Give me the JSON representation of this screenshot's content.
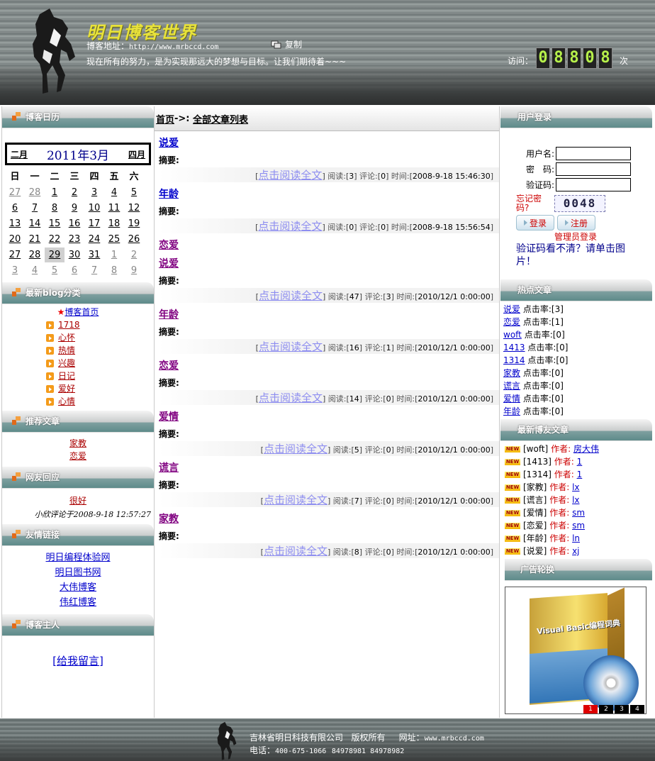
{
  "header": {
    "logo_text": "明日博客世界",
    "address_label": "博客地址：",
    "address_url": "http://www.mrbccd.com",
    "copy_label": "复制",
    "slogan": "现在所有的努力，是为实现那远大的梦想与目标。让我们期待着~~~",
    "visit_label": "访问：",
    "visit_count": [
      "0",
      "8",
      "8",
      "0",
      "8"
    ],
    "visit_unit": "次"
  },
  "left": {
    "calendar": {
      "title": "博客日历",
      "prev": "二月",
      "month": "2011年3月",
      "next": "四月",
      "weekdays": [
        "日",
        "一",
        "二",
        "三",
        "四",
        "五",
        "六"
      ],
      "days": [
        [
          "27",
          "28",
          "1",
          "2",
          "3",
          "4",
          "5"
        ],
        [
          "6",
          "7",
          "8",
          "9",
          "10",
          "11",
          "12"
        ],
        [
          "13",
          "14",
          "15",
          "16",
          "17",
          "18",
          "19"
        ],
        [
          "20",
          "21",
          "22",
          "23",
          "24",
          "25",
          "26"
        ],
        [
          "27",
          "28",
          "29",
          "30",
          "31",
          "1",
          "2"
        ],
        [
          "3",
          "4",
          "5",
          "6",
          "7",
          "8",
          "9"
        ]
      ]
    },
    "categories": {
      "title": "最新blog分类",
      "home": "博客首页",
      "items": [
        "1718",
        "心怀",
        "热情",
        "兴趣",
        "日记",
        "爱好",
        "心情"
      ]
    },
    "recommended": {
      "title": "推荐文章",
      "items": [
        "家教",
        "恋爱"
      ]
    },
    "replies": {
      "title": "网友回应",
      "text": "很好",
      "meta": "小欣评论于2008-9-18 12:57:27"
    },
    "links": {
      "title": "友情链接",
      "items": [
        "明日编程体验网",
        "明日图书网",
        "大伟博客",
        "伟红博客"
      ]
    },
    "owner": {
      "title": "博客主人",
      "message_link": "[给我留言]"
    }
  },
  "middle": {
    "crumb_home": "首页",
    "crumb_sep": "->:",
    "crumb_current": "全部文章列表",
    "summary_label": "摘要:",
    "read_more": "点击阅读全文",
    "read_label": "阅读:",
    "comment_label": "评论:",
    "time_label": "时间:",
    "articles": [
      {
        "title": "说爱",
        "reads": "3",
        "comments": "0",
        "time": "2008-9-18 15:46:30"
      },
      {
        "title": "年龄",
        "reads": "0",
        "comments": "0",
        "time": "2008-9-18 15:56:54"
      },
      {
        "title": "恋爱"
      },
      {
        "title": "说爱",
        "reads": "47",
        "comments": "3",
        "time": "2010/12/1 0:00:00"
      },
      {
        "title": "年龄",
        "reads": "16",
        "comments": "1",
        "time": "2010/12/1 0:00:00"
      },
      {
        "title": "恋爱",
        "reads": "14",
        "comments": "0",
        "time": "2010/12/1 0:00:00"
      },
      {
        "title": "爱情",
        "reads": "5",
        "comments": "0",
        "time": "2010/12/1 0:00:00"
      },
      {
        "title": "谎言",
        "reads": "7",
        "comments": "0",
        "time": "2010/12/1 0:00:00"
      },
      {
        "title": "家教",
        "reads": "8",
        "comments": "0",
        "time": "2010/12/1 0:00:00"
      }
    ]
  },
  "right": {
    "login": {
      "title": "用户登录",
      "username_label": "用户名:",
      "password_label": "密　码:",
      "captcha_label": "验证码:",
      "forgot": "忘记密码?",
      "captcha_text": "0048",
      "login_btn": "登录",
      "register_btn": "注册",
      "admin_login": "管理员登录",
      "captcha_tip": "验证码看不清？请单击图片！"
    },
    "hot": {
      "title": "热点文章",
      "rate_label": "点击率:",
      "items": [
        {
          "name": "说爱",
          "rate": "[3]"
        },
        {
          "name": "恋爱",
          "rate": "[1]"
        },
        {
          "name": "woft",
          "rate": "[0]"
        },
        {
          "name": "1413",
          "rate": "[0]"
        },
        {
          "name": "1314",
          "rate": "[0]"
        },
        {
          "name": "家教",
          "rate": "[0]"
        },
        {
          "name": "谎言",
          "rate": "[0]"
        },
        {
          "name": "爱情",
          "rate": "[0]"
        },
        {
          "name": "年龄",
          "rate": "[0]"
        }
      ]
    },
    "newest": {
      "title": "最新博友文章",
      "new_badge": "NEW",
      "author_label": "作者:",
      "items": [
        {
          "name": "[woft]",
          "author": "房大伟"
        },
        {
          "name": "[1413]",
          "author": "1"
        },
        {
          "name": "[1314]",
          "author": "1"
        },
        {
          "name": "[家教]",
          "author": "lx"
        },
        {
          "name": "[谎言]",
          "author": "lx"
        },
        {
          "name": "[爱情]",
          "author": "sm"
        },
        {
          "name": "[恋爱]",
          "author": "sm"
        },
        {
          "name": "[年龄]",
          "author": "ln"
        },
        {
          "name": "[说爱]",
          "author": "xj"
        }
      ]
    },
    "ad": {
      "title": "广告轮换",
      "product": "Visual Basic编程词典",
      "pages": [
        "1",
        "2",
        "3",
        "4"
      ]
    }
  },
  "footer": {
    "company": "吉林省明日科技有限公司",
    "rights": "版权所有",
    "site_label": "网址：",
    "site": "www.mrbccd.com",
    "phone_label": "电话：",
    "phone": "400-675-1066",
    "phones2": "84978981 84978982"
  }
}
